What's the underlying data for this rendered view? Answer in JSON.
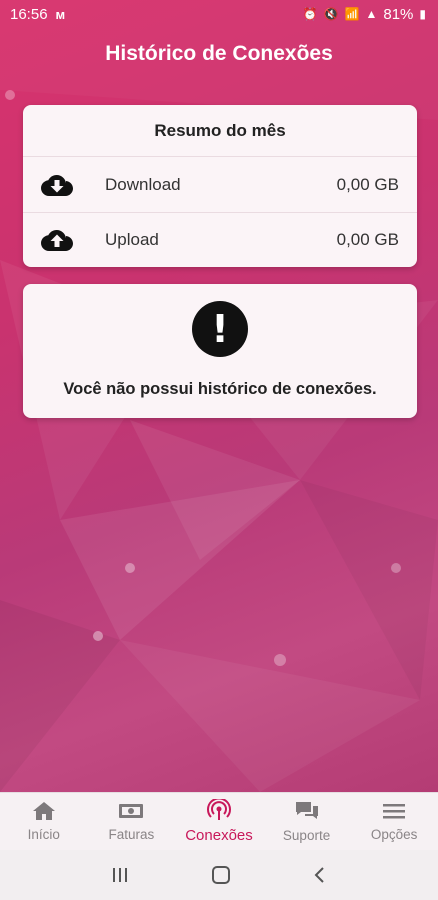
{
  "status_bar": {
    "time": "16:56",
    "carrier_icon": "signal-m-icon",
    "battery": "81%"
  },
  "header": {
    "title": "Histórico de Conexões"
  },
  "summary": {
    "title": "Resumo do mês",
    "rows": [
      {
        "icon": "cloud-download-icon",
        "label": "Download",
        "value": "0,00 GB"
      },
      {
        "icon": "cloud-upload-icon",
        "label": "Upload",
        "value": "0,00 GB"
      }
    ]
  },
  "empty_state": {
    "icon": "exclamation-icon",
    "message": "Você não possui histórico de conexões."
  },
  "bottom_nav": {
    "active": "Conexões",
    "items": [
      {
        "label": "Início",
        "icon": "home-icon"
      },
      {
        "label": "Faturas",
        "icon": "money-icon"
      },
      {
        "label": "Conexões",
        "icon": "broadcast-icon"
      },
      {
        "label": "Suporte",
        "icon": "chat-icon"
      },
      {
        "label": "Opções",
        "icon": "menu-icon"
      }
    ]
  },
  "colors": {
    "accent": "#c8185a",
    "background": "#c9336f",
    "card": "#fbf4f7"
  }
}
